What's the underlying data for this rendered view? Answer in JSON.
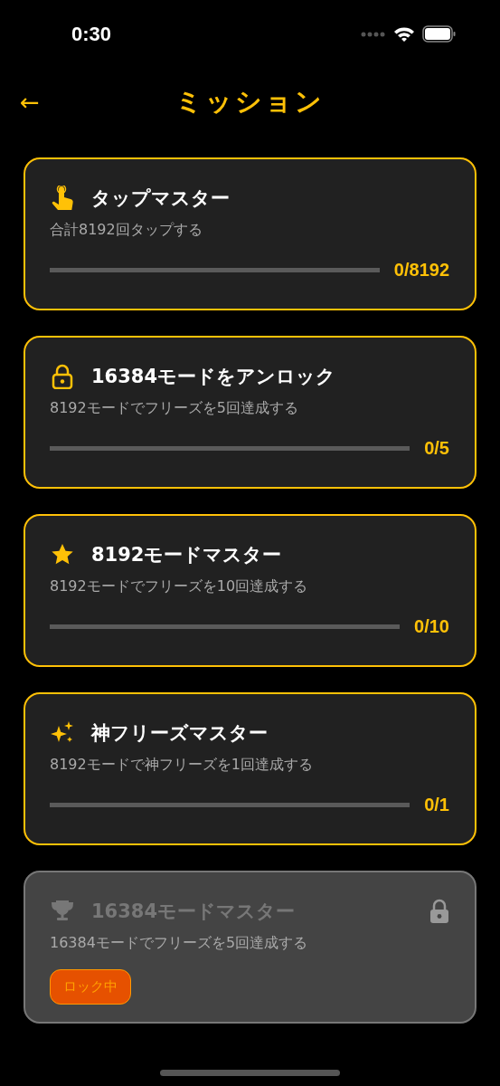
{
  "status_bar": {
    "time": "0:30"
  },
  "header": {
    "back": "←",
    "title": "ミッション"
  },
  "missions": [
    {
      "title": "タップマスター",
      "description": "合計8192回タップする",
      "locked": false,
      "level": 0,
      "progress": "0/8192"
    },
    {
      "title": "16384モードをアンロック",
      "description": "8192モードでフリーズを5回達成する",
      "locked": false,
      "level": 0,
      "progress": "0/5"
    },
    {
      "title": "8192モードマスター",
      "description": "8192モードでフリーズを10回達成する",
      "locked": false,
      "level": 0,
      "progress": "0/10"
    },
    {
      "title": "神フリーズマスター",
      "description": "8192モードで神フリーズを1回達成する",
      "locked": false,
      "level": 0,
      "progress": "0/1"
    },
    {
      "title": "16384モードマスター",
      "description": "16384モードでフリーズを5回達成する",
      "locked": true,
      "badge": "ロック中"
    }
  ]
}
